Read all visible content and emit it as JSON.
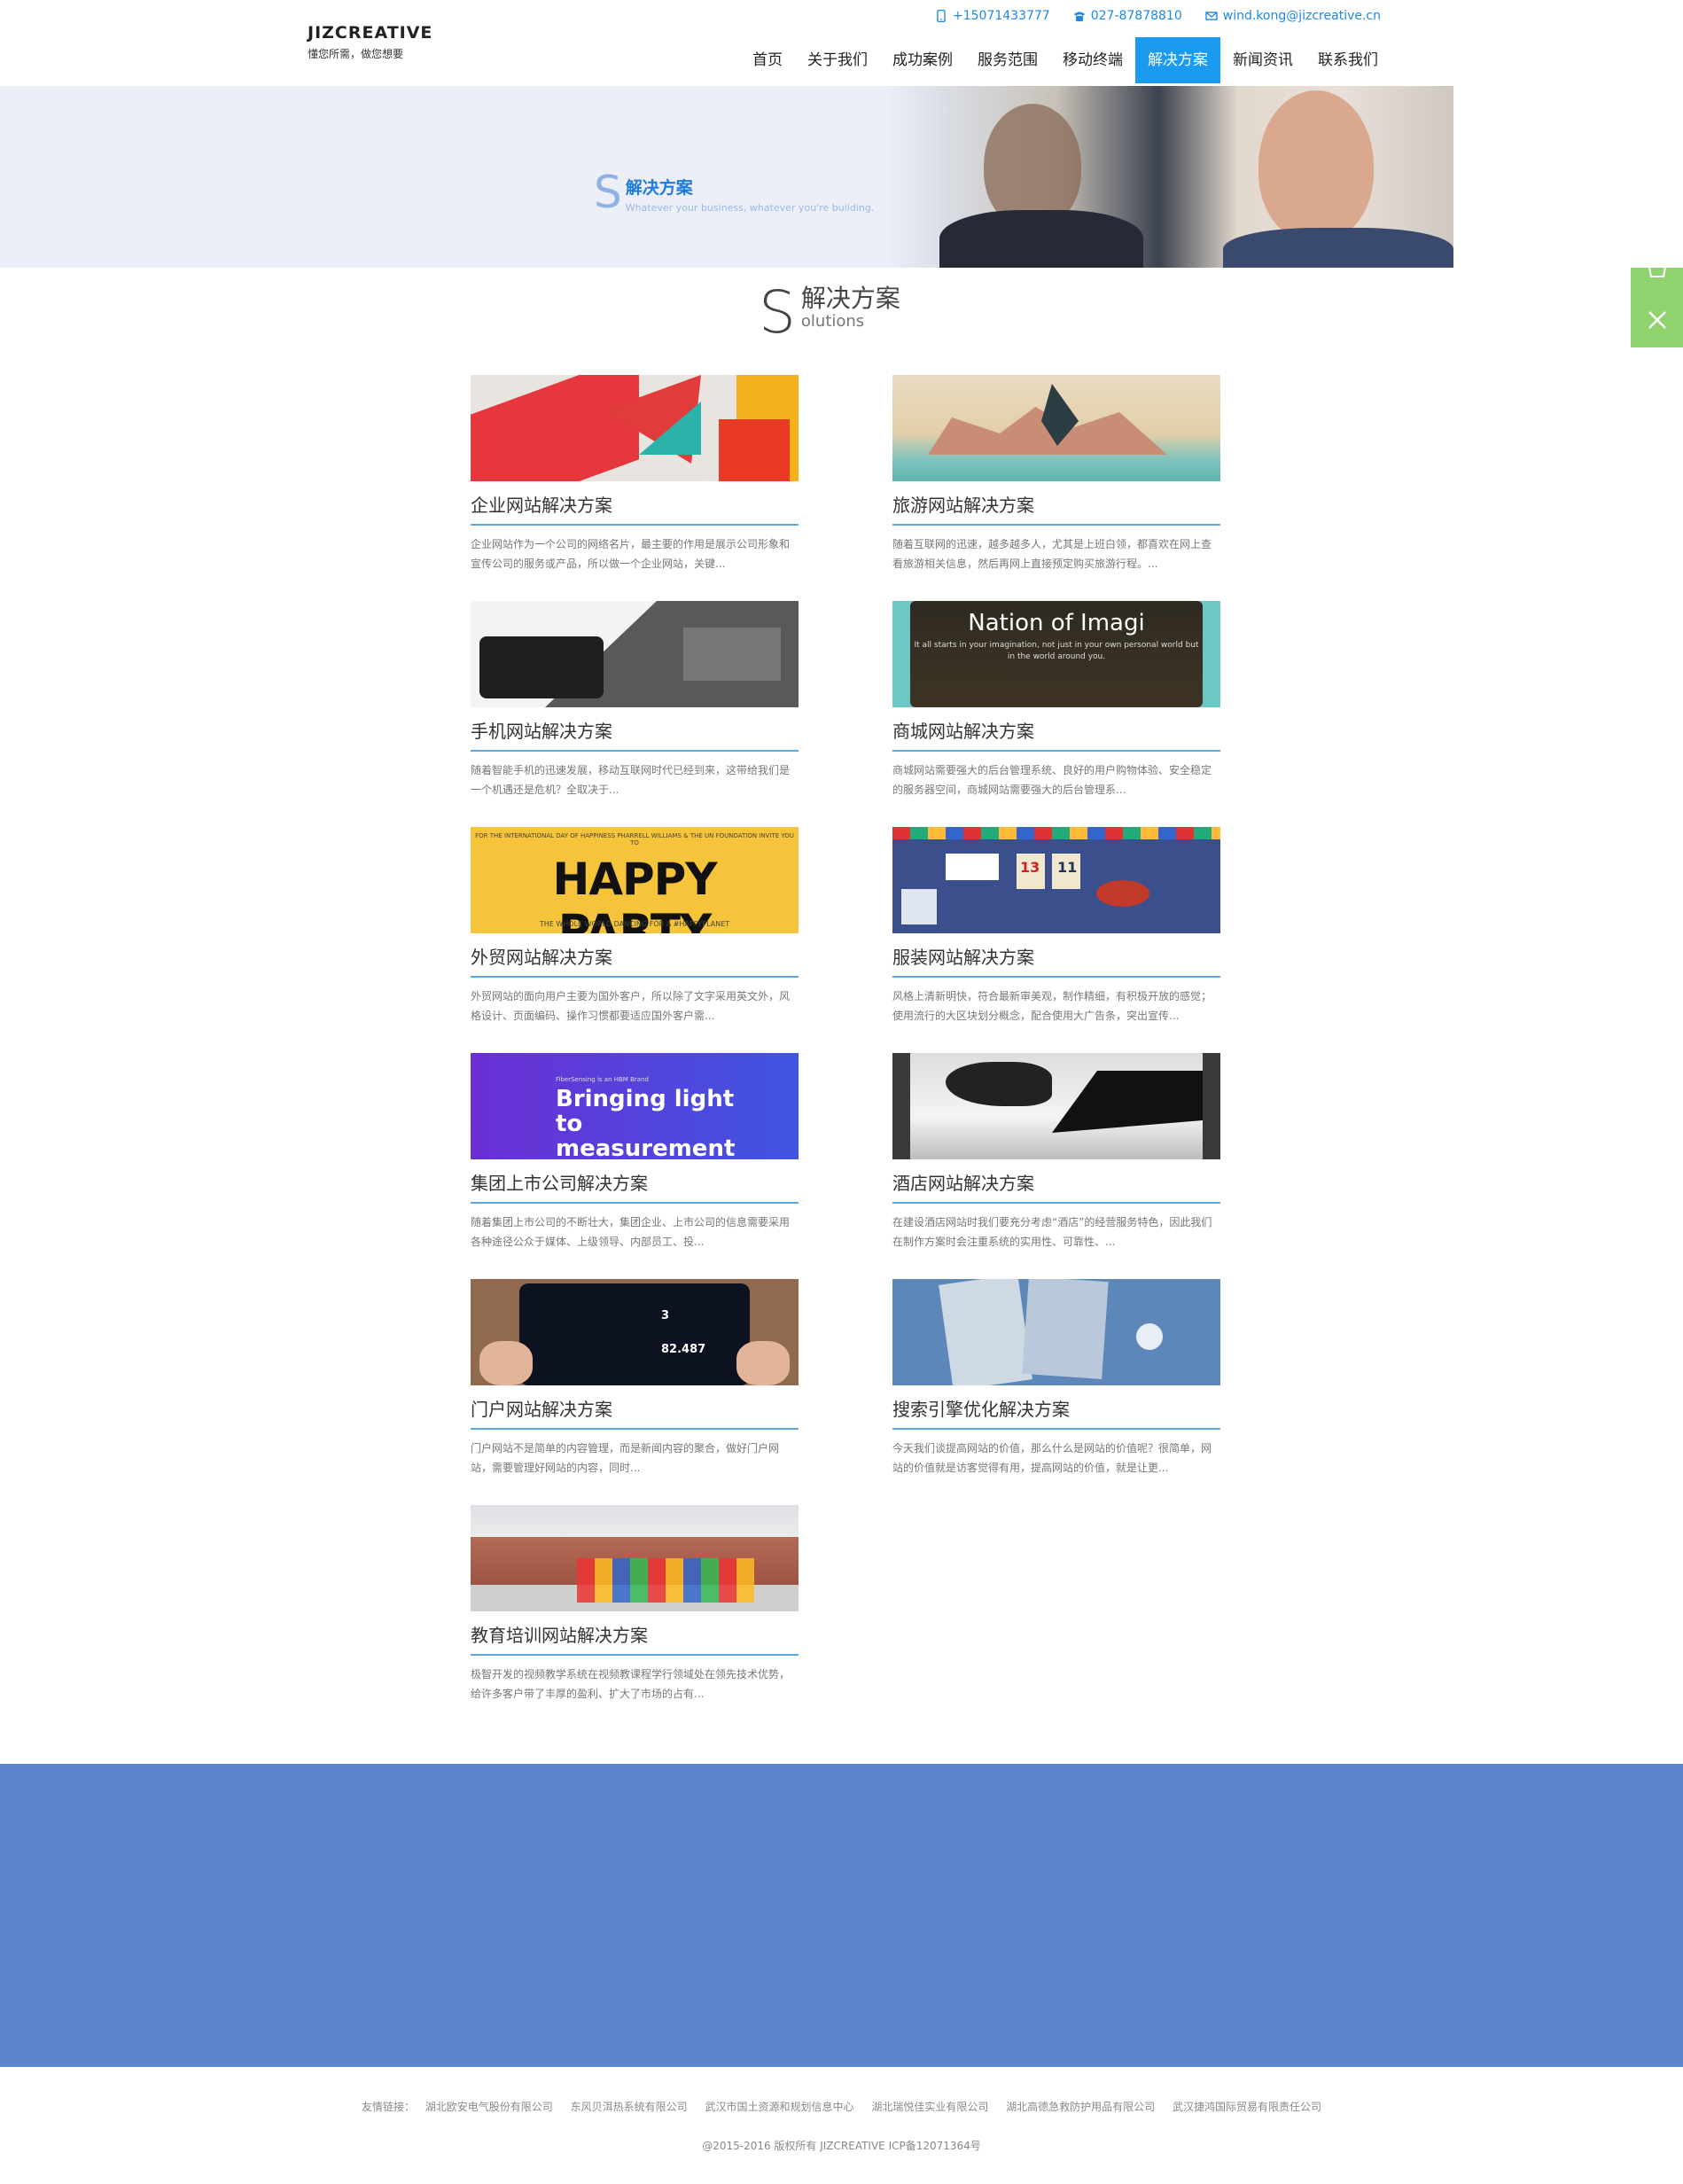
{
  "brand": {
    "name": "JIZCREATIVE",
    "tagline": "懂您所需，做您想要"
  },
  "contacts": [
    {
      "icon": "phone-icon",
      "text": "+15071433777"
    },
    {
      "icon": "telephone-icon",
      "text": "027-87878810"
    },
    {
      "icon": "mail-icon",
      "text": "wind.kong@jizcreative.cn"
    }
  ],
  "nav": {
    "items": [
      {
        "label": "首页"
      },
      {
        "label": "关于我们"
      },
      {
        "label": "成功案例"
      },
      {
        "label": "服务范围"
      },
      {
        "label": "移动终端"
      },
      {
        "label": "解决方案"
      },
      {
        "label": "新闻资讯"
      },
      {
        "label": "联系我们"
      }
    ],
    "active_index": 5
  },
  "banner": {
    "letter": "S",
    "title": "解决方案",
    "subtitle": "Whatever your business, whatever you're building."
  },
  "section": {
    "letter": "S",
    "title_cn": "解决方案",
    "title_en": "olutions"
  },
  "cards": [
    {
      "title": "企业网站解决方案",
      "desc": "企业网站作为一个公司的网络名片，最主要的作用是展示公司形象和宣传公司的服务或产品，所以做一个企业网站，关键..."
    },
    {
      "title": "旅游网站解决方案",
      "desc": "随着互联网的迅速，越多越多人，尤其是上班白领，都喜欢在网上查看旅游相关信息，然后再网上直接预定购买旅游行程。..."
    },
    {
      "title": "手机网站解决方案",
      "desc": "随着智能手机的迅速发展，移动互联网时代已经到来，这带给我们是一个机遇还是危机？全取决于..."
    },
    {
      "title": "商城网站解决方案",
      "desc": "商城网站需要强大的后台管理系统、良好的用户购物体验、安全稳定的服务器空间，商城网站需要强大的后台管理系..."
    },
    {
      "title": "外贸网站解决方案",
      "desc": "外贸网站的面向用户主要为国外客户，所以除了文字采用英文外，风格设计、页面编码、操作习惯都要适应国外客户需..."
    },
    {
      "title": "服装网站解决方案",
      "desc": "风格上清新明快，符合最新审美观，制作精细，有积极开放的感觉；使用流行的大区块划分概念，配合使用大广告条，突出宣传..."
    },
    {
      "title": "集团上市公司解决方案",
      "desc": "随着集团上市公司的不断壮大，集团企业、上市公司的信息需要采用各种途径公众于媒体、上级领导、内部员工、投..."
    },
    {
      "title": "酒店网站解决方案",
      "desc": "在建设酒店网站时我们要充分考虑“酒店”的经营服务特色，因此我们在制作方案时会注重系统的实用性、可靠性、..."
    },
    {
      "title": "门户网站解决方案",
      "desc": "门户网站不是简单的内容管理，而是新闻内容的聚合，做好门户网站，需要管理好网站的内容，同时..."
    },
    {
      "title": "搜索引擎优化解决方案",
      "desc": "今天我们谈提高网站的价值，那么什么是网站的价值呢？很简单，网站的价值就是访客觉得有用，提高网站的价值，就是让更..."
    },
    {
      "title": "教育培训网站解决方案",
      "desc": "极智开发的视频教学系统在视频教课程学行领域处在领先技术优势，给许多客户带了丰厚的盈利、扩大了市场的占有..."
    }
  ],
  "thumbs": {
    "t4": {
      "big": "Nation of Imagi",
      "small": "It all starts in your imagination, not just in your own personal world but in the world around you."
    },
    "t5": {
      "small1": "FOR THE INTERNATIONAL DAY OF HAPPINESS PHARRELL WILLIAMS & THE UN FOUNDATION INVITE YOU TO",
      "big": "HAPPY PARTY",
      "small2": "THE WHOLE WORLD DANCING FOR A #HAPPYPLANET"
    },
    "t6": {
      "n1": "13",
      "n2": "11"
    },
    "t7": {
      "small": "FiberSensing is an HBM Brand",
      "big": "Bringing light to measurement"
    },
    "t9": {
      "n1": "3",
      "n2": "82.487"
    }
  },
  "footer": {
    "links_label": "友情链接：",
    "links": [
      "湖北欧安电气股份有限公司",
      "东风贝洱热系统有限公司",
      "武汉市国土资源和规划信息中心",
      "湖北瑞悦佳实业有限公司",
      "湖北高德急救防护用品有限公司",
      "武汉捷鸿国际贸易有限责任公司"
    ],
    "copyright": "@2015-2016 版权所有 JIZCREATIVE ICP备12071364号"
  },
  "colors": {
    "accent": "#1a9bf0",
    "band": "#5b86cd",
    "side": "#8ed36e"
  }
}
